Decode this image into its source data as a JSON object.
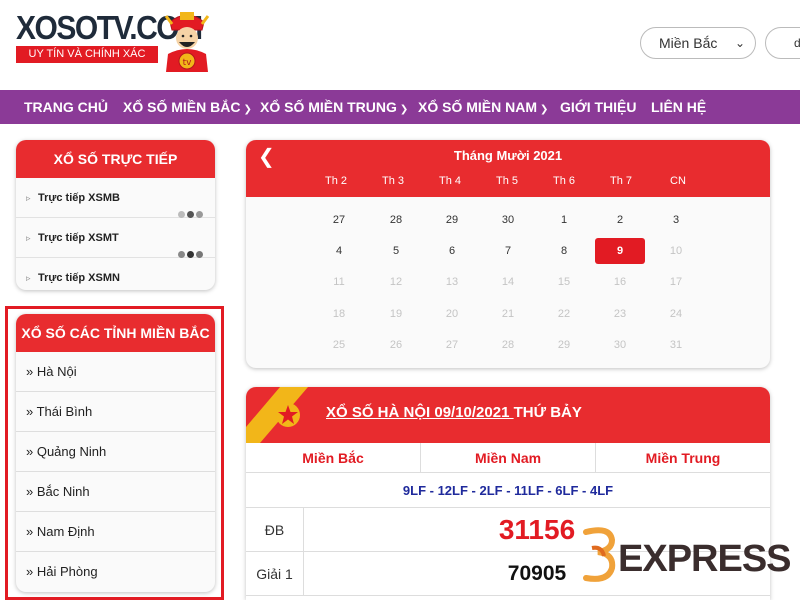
{
  "header": {
    "logo_text": "XOSOTV.COM",
    "logo_tagline": "UY TÍN VÀ CHÍNH XÁC",
    "region_select": "Miền Bắc",
    "search_partial": "d"
  },
  "nav": [
    {
      "label": "TRANG CHỦ",
      "has_dropdown": false
    },
    {
      "label": "XỔ SỐ MIỀN BẮC",
      "has_dropdown": true
    },
    {
      "label": "XỔ SỐ MIỀN TRUNG",
      "has_dropdown": true
    },
    {
      "label": "XỔ SỐ MIỀN NAM",
      "has_dropdown": true
    },
    {
      "label": "GIỚI THIỆU",
      "has_dropdown": false
    },
    {
      "label": "LIÊN HỆ",
      "has_dropdown": false
    }
  ],
  "live_box": {
    "title": "XỔ SỐ TRỰC TIẾP",
    "items": [
      "Trực tiếp XSMB",
      "Trực tiếp XSMT",
      "Trực tiếp XSMN"
    ]
  },
  "provinces_box": {
    "title": "XỔ SỐ CÁC TỈNH MIỀN BẮC",
    "items": [
      "» Hà Nội",
      "» Thái Bình",
      "» Quảng Ninh",
      "» Bắc Ninh",
      "» Nam Định",
      "» Hải Phòng"
    ]
  },
  "calendar": {
    "title": "Tháng Mười 2021",
    "weekdays": [
      "Th 2",
      "Th 3",
      "Th 4",
      "Th 5",
      "Th 6",
      "Th 7",
      "CN"
    ],
    "selected_day": 9,
    "rows": [
      [
        "27",
        "28",
        "29",
        "30",
        "1",
        "2",
        "3"
      ],
      [
        "4",
        "5",
        "6",
        "7",
        "8",
        "9",
        "10"
      ],
      [
        "11",
        "12",
        "13",
        "14",
        "15",
        "16",
        "17"
      ],
      [
        "18",
        "19",
        "20",
        "21",
        "22",
        "23",
        "24"
      ],
      [
        "25",
        "26",
        "27",
        "28",
        "29",
        "30",
        "31"
      ]
    ]
  },
  "result": {
    "title_link": "XỔ SỐ HÀ NỘI 09/10/2021 ",
    "title_suffix": "THỨ BẢY",
    "tabs": [
      "Miền Bắc",
      "Miền Nam",
      "Miền Trung"
    ],
    "codes": "9LF - 12LF - 2LF - 11LF - 6LF - 4LF",
    "prizes": [
      {
        "label": "ĐB",
        "value": "31156"
      },
      {
        "label": "Giải 1",
        "value": "70905"
      }
    ]
  },
  "watermark": {
    "text": "EXPRESS",
    "logo_numeral": "35"
  },
  "colors": {
    "brand_red": "#e21b23",
    "nav_purple": "#8b3a97",
    "code_blue": "#1f2a9c"
  }
}
